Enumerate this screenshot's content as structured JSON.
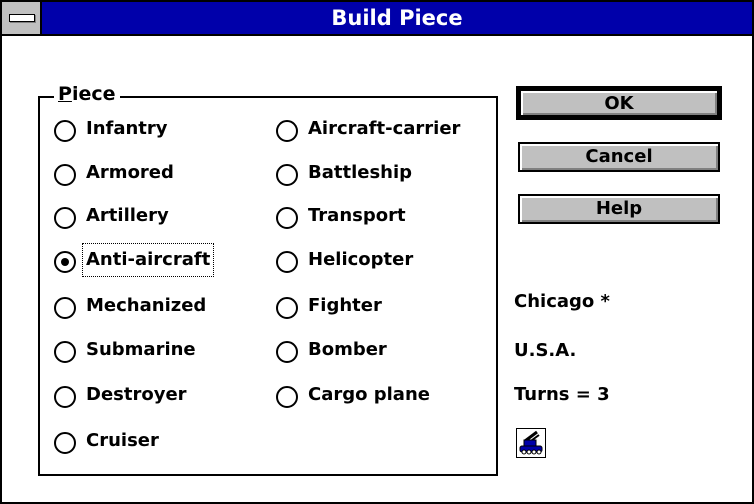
{
  "window": {
    "title": "Build Piece"
  },
  "group": {
    "legend_mnemonic": "P",
    "legend_rest": "iece"
  },
  "pieces": [
    {
      "label": "Infantry",
      "selected": false
    },
    {
      "label": "Armored",
      "selected": false
    },
    {
      "label": "Artillery",
      "selected": false
    },
    {
      "label": "Anti-aircraft",
      "selected": true
    },
    {
      "label": "Mechanized",
      "selected": false
    },
    {
      "label": "Submarine",
      "selected": false
    },
    {
      "label": "Destroyer",
      "selected": false
    },
    {
      "label": "Cruiser",
      "selected": false
    },
    {
      "label": "Aircraft-carrier",
      "selected": false
    },
    {
      "label": "Battleship",
      "selected": false
    },
    {
      "label": "Transport",
      "selected": false
    },
    {
      "label": "Helicopter",
      "selected": false
    },
    {
      "label": "Fighter",
      "selected": false
    },
    {
      "label": "Bomber",
      "selected": false
    },
    {
      "label": "Cargo plane",
      "selected": false
    }
  ],
  "buttons": {
    "ok": "OK",
    "cancel": "Cancel",
    "help": "Help"
  },
  "info": {
    "city": "Chicago *",
    "country": "U.S.A.",
    "turns": "Turns =  3"
  },
  "icons": {
    "unit": "anti-aircraft-unit-icon",
    "system_menu": "system-menu-icon"
  },
  "colors": {
    "titlebar": "#0000aa",
    "button_face": "#c0c0c0"
  }
}
